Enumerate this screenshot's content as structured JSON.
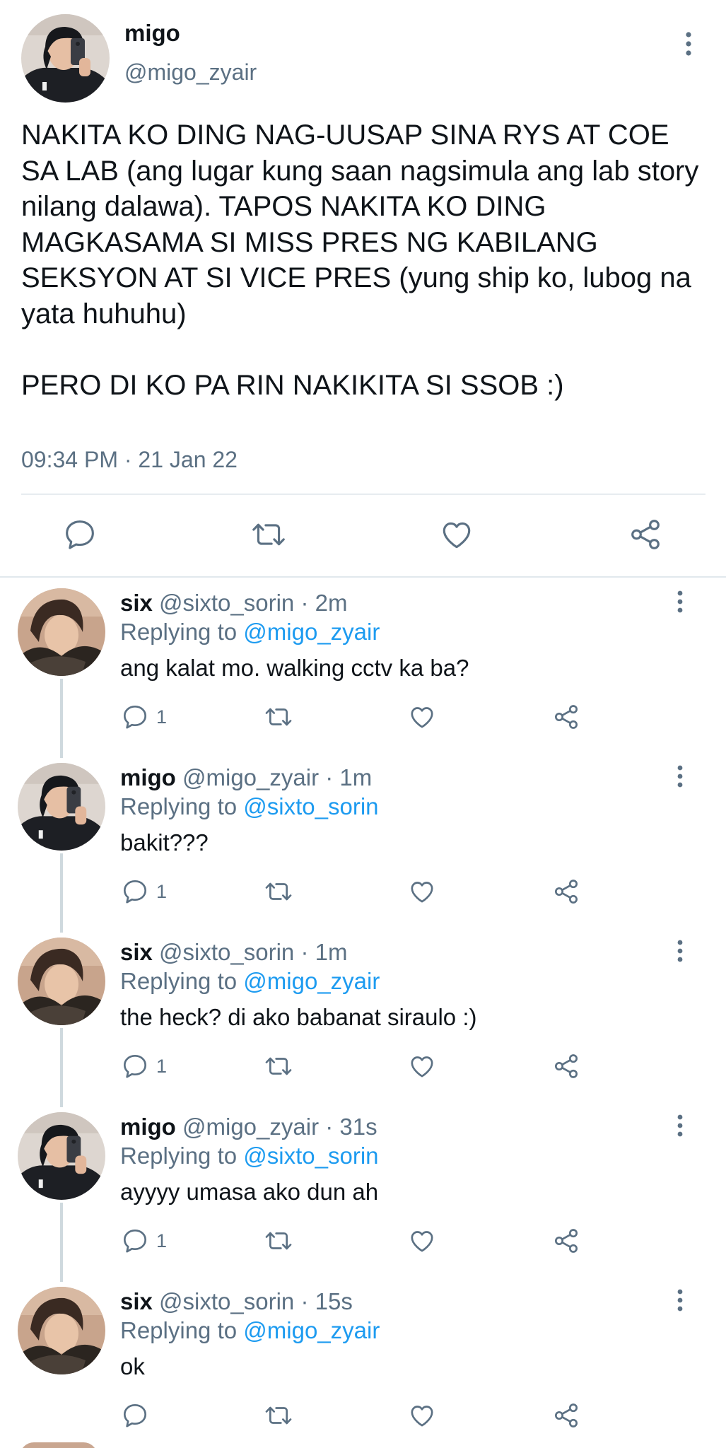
{
  "main_tweet": {
    "display_name": "migo",
    "handle": "@migo_zyair",
    "body_paragraphs": [
      "NAKITA KO DING NAG-UUSAP SINA RYS AT COE SA LAB (ang lugar kung saan nagsimula ang lab story nilang dalawa). TAPOS NAKITA KO DING MAGKASAMA SI MISS PRES NG KABILANG SEKSYON AT SI VICE PRES (yung ship ko, lubog na yata huhuhu)",
      "PERO DI KO PA RIN NAKIKITA SI SSOB :)"
    ],
    "timestamp": "09:34 PM · 21 Jan 22",
    "actions": [
      "reply-icon",
      "retweet-icon",
      "like-icon",
      "share-icon"
    ]
  },
  "replies": [
    {
      "display_name": "six",
      "handle": "@sixto_sorin",
      "separator": "·",
      "time": "2m",
      "replying_label": "Replying to",
      "replying_to": "@migo_zyair",
      "text": "ang kalat mo. walking cctv ka ba?",
      "reply_count": "1",
      "avatar": "six"
    },
    {
      "display_name": "migo",
      "handle": "@migo_zyair",
      "separator": "·",
      "time": "1m",
      "replying_label": "Replying to",
      "replying_to": "@sixto_sorin",
      "text": "bakit???",
      "reply_count": "1",
      "avatar": "migo"
    },
    {
      "display_name": "six",
      "handle": "@sixto_sorin",
      "separator": "·",
      "time": "1m",
      "replying_label": "Replying to",
      "replying_to": "@migo_zyair",
      "text": "the heck? di ako babanat siraulo :)",
      "reply_count": "1",
      "avatar": "six"
    },
    {
      "display_name": "migo",
      "handle": "@migo_zyair",
      "separator": "·",
      "time": "31s",
      "replying_label": "Replying to",
      "replying_to": "@sixto_sorin",
      "text": "ayyyy umasa ako dun ah",
      "reply_count": "1",
      "avatar": "migo"
    },
    {
      "display_name": "six",
      "handle": "@sixto_sorin",
      "separator": "·",
      "time": "15s",
      "replying_label": "Replying to",
      "replying_to": "@migo_zyair",
      "text": "ok",
      "reply_count": "",
      "avatar": "six"
    }
  ],
  "colors": {
    "text_primary": "#0f1419",
    "text_secondary": "#5b7083",
    "link": "#1d9bf0",
    "divider": "#e7ecf0",
    "thread_line": "#cfd9de"
  }
}
